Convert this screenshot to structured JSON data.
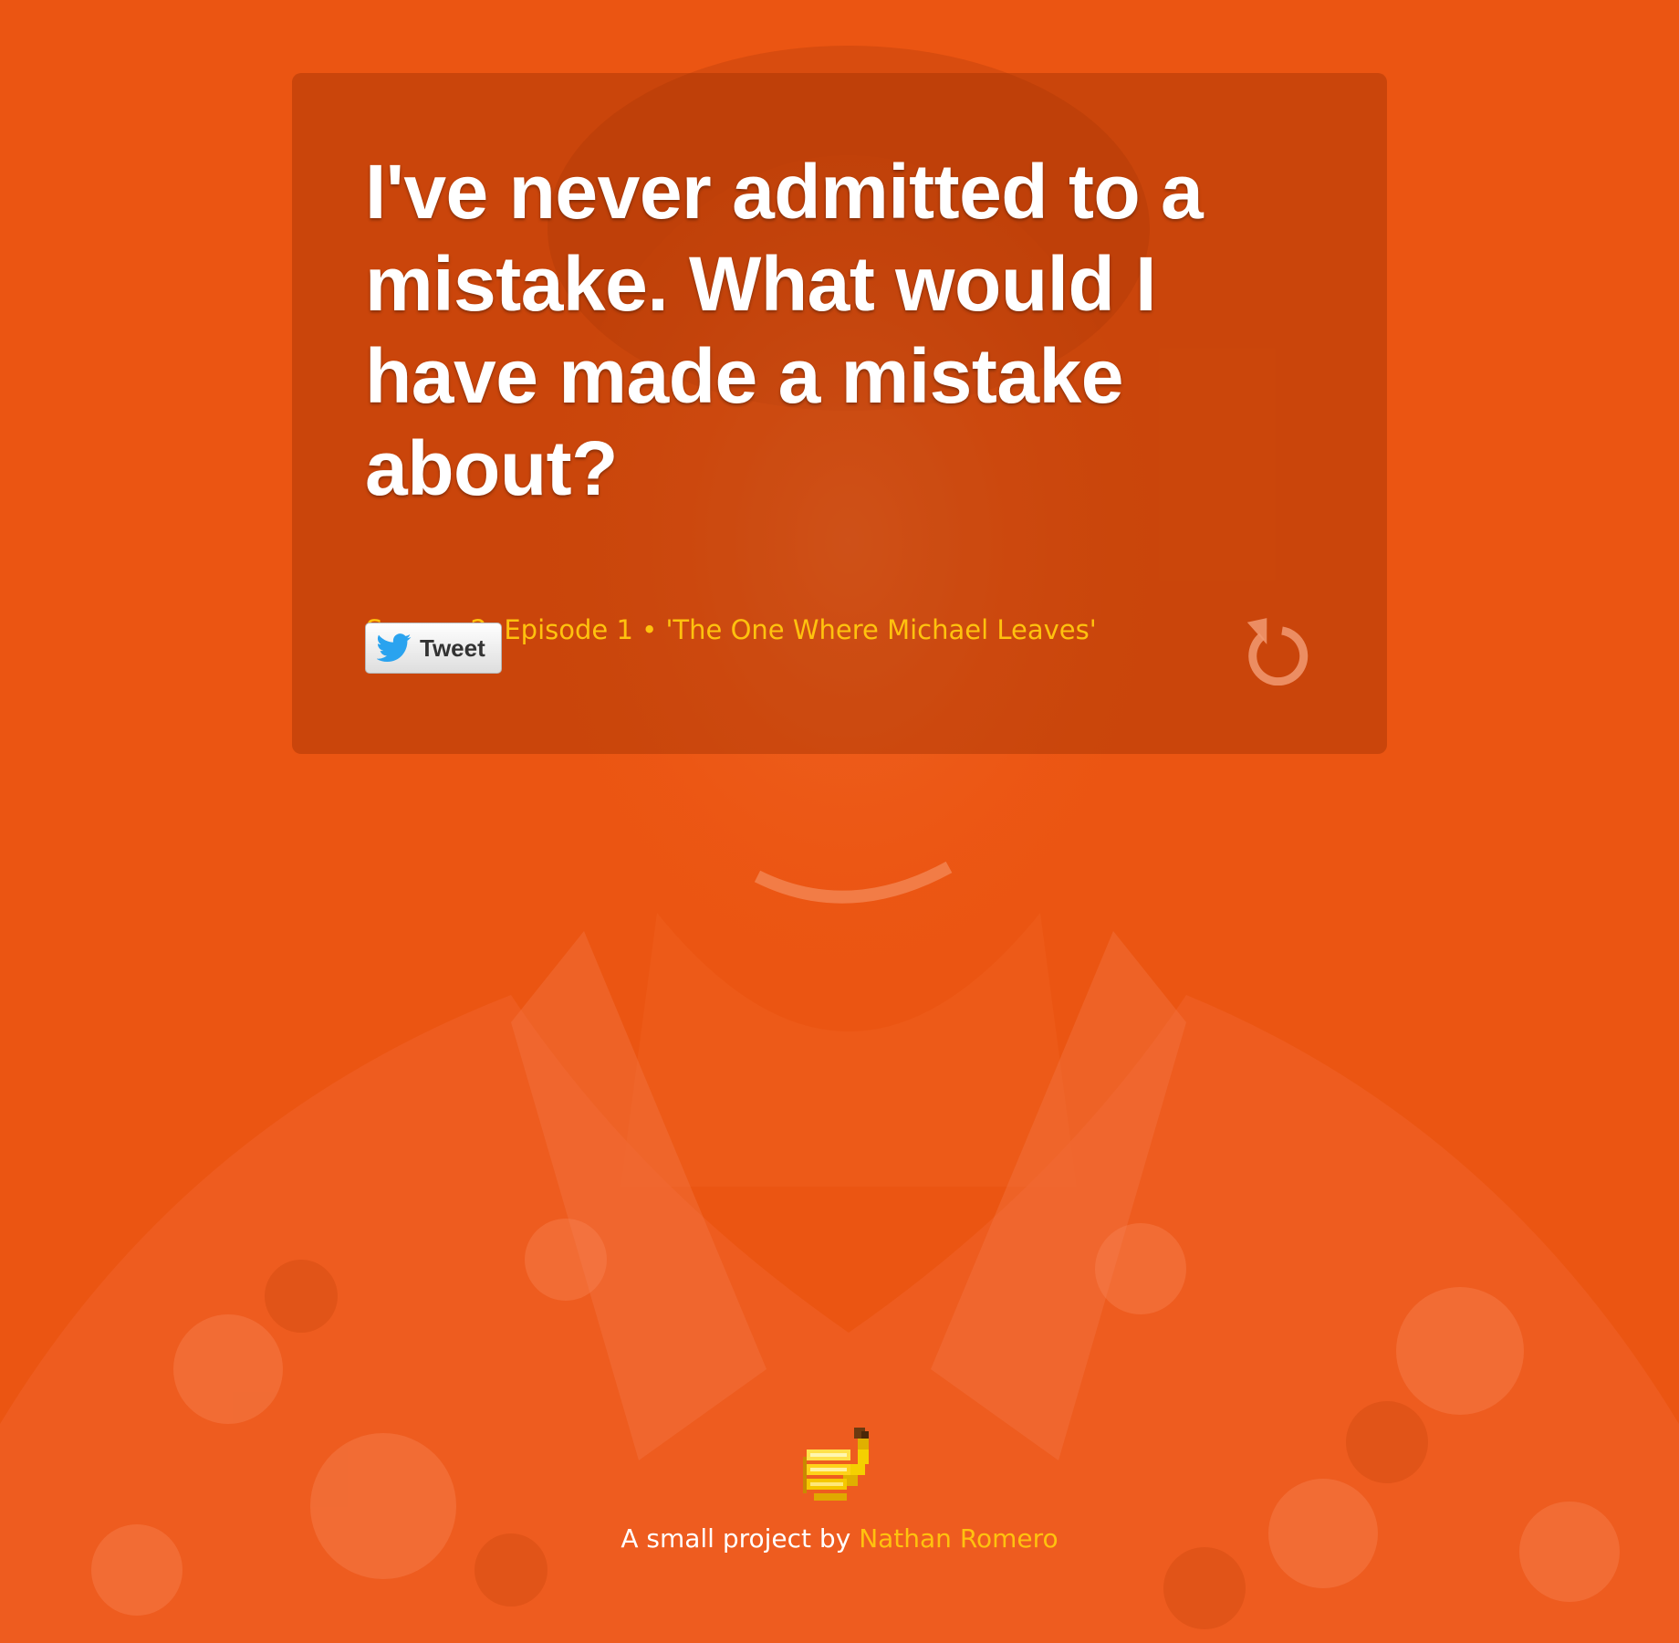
{
  "colors": {
    "background": "#eb5512",
    "accent": "#ffc20e",
    "quote_text": "#ffffff"
  },
  "quote": {
    "text": "I've never admitted to a mistake. What would I have made a mistake about?"
  },
  "episode": {
    "label": "Season 2, Episode 1 • 'The One Where Michael Leaves'"
  },
  "share": {
    "tweet_label": "Tweet",
    "icon": "twitter-bird-icon"
  },
  "controls": {
    "refresh_icon": "refresh-icon"
  },
  "footer": {
    "logo_icon": "banana-icon",
    "prefix": "A small project by",
    "author": "Nathan Romero"
  }
}
